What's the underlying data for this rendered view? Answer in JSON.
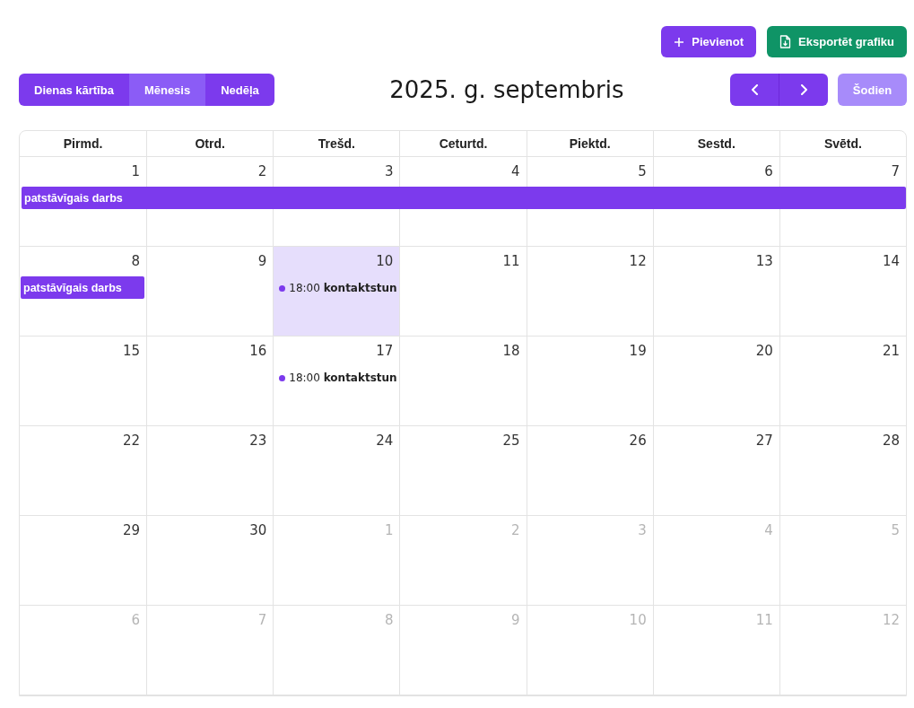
{
  "actions": [
    {
      "kind": "add",
      "label": "Pievienot"
    },
    {
      "kind": "export",
      "label": "Eksportēt grafiku"
    }
  ],
  "views": [
    {
      "label": "Dienas kārtība",
      "selected": false
    },
    {
      "label": "Mēnesis",
      "selected": true
    },
    {
      "label": "Nedēļa",
      "selected": false
    }
  ],
  "title": "2025. g. septembris",
  "today_button": {
    "label": "Šodien",
    "disabled": true
  },
  "weekdays": [
    "Pirmd.",
    "Otrd.",
    "Trešd.",
    "Ceturtd.",
    "Piektd.",
    "Sestd.",
    "Svētd."
  ],
  "weeks": [
    {
      "days": [
        {
          "number": "1",
          "other_month": false,
          "today": false,
          "events": [
            {
              "kind": "allday",
              "title": "patstāvīgais darbs",
              "spans_week": true
            }
          ]
        },
        {
          "number": "2",
          "other_month": false,
          "today": false
        },
        {
          "number": "3",
          "other_month": false,
          "today": false
        },
        {
          "number": "4",
          "other_month": false,
          "today": false
        },
        {
          "number": "5",
          "other_month": false,
          "today": false
        },
        {
          "number": "6",
          "other_month": false,
          "today": false
        },
        {
          "number": "7",
          "other_month": false,
          "today": false
        }
      ]
    },
    {
      "days": [
        {
          "number": "8",
          "other_month": false,
          "today": false,
          "events": [
            {
              "kind": "allday",
              "title": "patstāvīgais darbs",
              "spans_week": false
            }
          ]
        },
        {
          "number": "9",
          "other_month": false,
          "today": false
        },
        {
          "number": "10",
          "other_month": false,
          "today": true,
          "events": [
            {
              "kind": "timed",
              "time": "18:00",
              "title": "kontaktstun"
            }
          ]
        },
        {
          "number": "11",
          "other_month": false,
          "today": false
        },
        {
          "number": "12",
          "other_month": false,
          "today": false
        },
        {
          "number": "13",
          "other_month": false,
          "today": false
        },
        {
          "number": "14",
          "other_month": false,
          "today": false
        }
      ]
    },
    {
      "days": [
        {
          "number": "15",
          "other_month": false,
          "today": false
        },
        {
          "number": "16",
          "other_month": false,
          "today": false
        },
        {
          "number": "17",
          "other_month": false,
          "today": false,
          "events": [
            {
              "kind": "timed",
              "time": "18:00",
              "title": "kontaktstun"
            }
          ]
        },
        {
          "number": "18",
          "other_month": false,
          "today": false
        },
        {
          "number": "19",
          "other_month": false,
          "today": false
        },
        {
          "number": "20",
          "other_month": false,
          "today": false
        },
        {
          "number": "21",
          "other_month": false,
          "today": false
        }
      ]
    },
    {
      "days": [
        {
          "number": "22",
          "other_month": false,
          "today": false
        },
        {
          "number": "23",
          "other_month": false,
          "today": false
        },
        {
          "number": "24",
          "other_month": false,
          "today": false
        },
        {
          "number": "25",
          "other_month": false,
          "today": false
        },
        {
          "number": "26",
          "other_month": false,
          "today": false
        },
        {
          "number": "27",
          "other_month": false,
          "today": false
        },
        {
          "number": "28",
          "other_month": false,
          "today": false
        }
      ]
    },
    {
      "days": [
        {
          "number": "29",
          "other_month": false,
          "today": false
        },
        {
          "number": "30",
          "other_month": false,
          "today": false
        },
        {
          "number": "1",
          "other_month": true,
          "today": false
        },
        {
          "number": "2",
          "other_month": true,
          "today": false
        },
        {
          "number": "3",
          "other_month": true,
          "today": false
        },
        {
          "number": "4",
          "other_month": true,
          "today": false
        },
        {
          "number": "5",
          "other_month": true,
          "today": false
        }
      ]
    },
    {
      "days": [
        {
          "number": "6",
          "other_month": true,
          "today": false
        },
        {
          "number": "7",
          "other_month": true,
          "today": false
        },
        {
          "number": "8",
          "other_month": true,
          "today": false
        },
        {
          "number": "9",
          "other_month": true,
          "today": false
        },
        {
          "number": "10",
          "other_month": true,
          "today": false
        },
        {
          "number": "11",
          "other_month": true,
          "today": false
        },
        {
          "number": "12",
          "other_month": true,
          "today": false
        }
      ]
    }
  ]
}
